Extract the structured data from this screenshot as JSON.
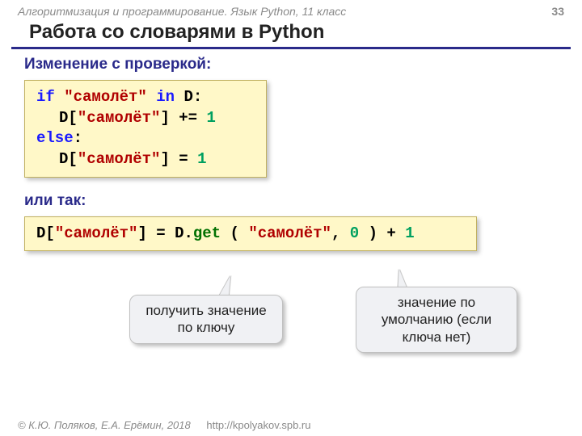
{
  "header": {
    "course": "Алгоритмизация и программирование. Язык Python, 11 класс",
    "page_number": "33"
  },
  "title": "Работа со словарями в Python",
  "section1_label": "Изменение с проверкой:",
  "code1": {
    "l1_kw_if": "if",
    "l1_str": "\"самолёт\"",
    "l1_kw_in": "in",
    "l1_var": "D:",
    "l2_lhs_var": "D[",
    "l2_lhs_str": "\"самолёт\"",
    "l2_lhs_br": "]",
    "l2_op": "+=",
    "l2_num": "1",
    "l3_kw_else": "else",
    "l3_colon": ":",
    "l4_lhs_var": "D[",
    "l4_lhs_str": "\"самолёт\"",
    "l4_lhs_br": "]",
    "l4_op": "=",
    "l4_num": "1"
  },
  "section2_label": "или так:",
  "code2": {
    "lhs_var": "D[",
    "lhs_str": "\"самолёт\"",
    "lhs_br": "]",
    "eq": "=",
    "d": "D",
    "dot": ".",
    "get": "get",
    "paren_open": "(",
    "arg1": "\"самолёт\"",
    "comma": ",",
    "arg2": "0",
    "paren_close": ")",
    "plus": "+",
    "one": "1"
  },
  "callout_left": "получить значение по ключу",
  "callout_right": "значение по умолчанию (если ключа нет)",
  "footer": {
    "authors": "© К.Ю. Поляков, Е.А. Ерёмин, 2018",
    "url": "http://kpolyakov.spb.ru"
  }
}
